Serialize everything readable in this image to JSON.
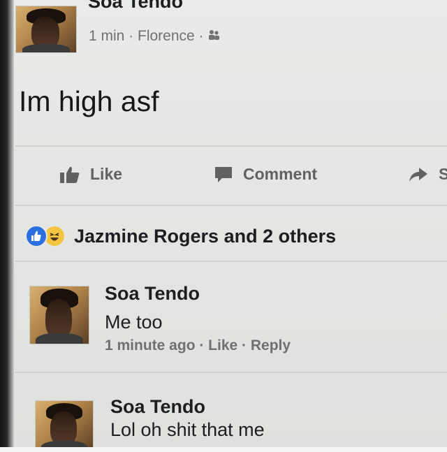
{
  "post": {
    "author": "Soa Tendo",
    "meta": "1 min · Florence · ",
    "audience_icon": "friends-icon",
    "text": "Im high asf"
  },
  "actions": {
    "like_label": "Like",
    "comment_label": "Comment",
    "share_label": "S"
  },
  "reactions": {
    "icons": [
      "like-icon",
      "haha-icon"
    ],
    "text": "Jazmine Rogers and 2 others"
  },
  "comments": [
    {
      "author": "Soa Tendo",
      "text": "Me too",
      "meta": "1 minute ago · Like · Reply"
    },
    {
      "author": "Soa Tendo",
      "text": "Lol oh shit that me"
    }
  ],
  "colors": {
    "like_blue": "#2c6fe0",
    "haha_yellow": "#f4c542",
    "text_dark": "#1c1e21",
    "meta_gray": "#707272",
    "background": "#e6e8e5"
  }
}
